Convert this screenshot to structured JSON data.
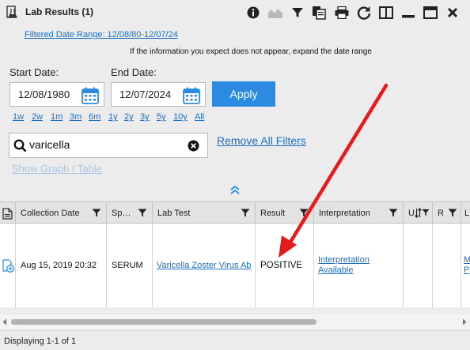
{
  "header": {
    "title": "Lab Results (1)",
    "toolbar": [
      "info-icon",
      "chart-icon",
      "filter-icon",
      "copy-icon",
      "print-icon",
      "refresh-icon",
      "split-view-icon",
      "minimize-icon",
      "maximize-icon",
      "close-icon"
    ]
  },
  "filter": {
    "date_range_link": "Filtered Date Range: 12/08/80-12/07/24",
    "info_message": "If the information you expect does not appear, expand the date range",
    "start_label": "Start Date:",
    "start_value": "12/08/1980",
    "end_label": "End Date:",
    "end_value": "12/07/2024",
    "apply_label": "Apply",
    "ranges": [
      "1w",
      "2w",
      "1m",
      "3m",
      "6m",
      "1y",
      "2y",
      "3y",
      "5y",
      "10y",
      "All"
    ],
    "search_value": "varicella",
    "remove_filters": "Remove All Filters",
    "show_graph": "Show Graph / Table"
  },
  "table": {
    "columns": [
      "Collection Date",
      "Sp…",
      "Lab Test",
      "Result",
      "Interpretation",
      "U",
      "R",
      "L"
    ],
    "rows": [
      {
        "collection_date": "Aug 15, 2019 20:32",
        "specimen": "SERUM",
        "lab_test": "Varicella Zoster Virus Ab",
        "result": "POSITIVE",
        "interpretation_1": "Interpretation",
        "interpretation_2": "Available",
        "trailing_1": "M",
        "trailing_2": "P"
      }
    ]
  },
  "footer": {
    "status": "Displaying 1-1 of 1"
  },
  "colors": {
    "accent": "#2b8be0",
    "link": "#1a6fc4",
    "annotation_arrow": "#e8191a"
  }
}
